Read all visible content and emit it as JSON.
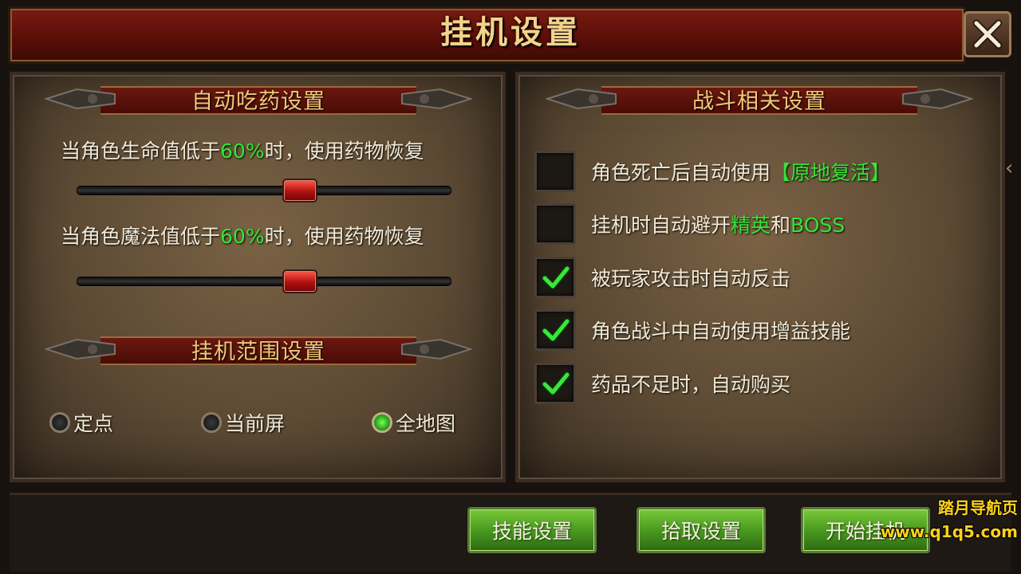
{
  "window": {
    "title": "挂机设置"
  },
  "left_panel": {
    "potion_header": "自动吃药设置",
    "hp": {
      "prefix": "当角色生命值低于",
      "percent": "60%",
      "suffix": "时，使用药物恢复",
      "slider_value": 0.6
    },
    "mp": {
      "prefix": "当角色魔法值低于",
      "percent": "60%",
      "suffix": "时，使用药物恢复",
      "slider_value": 0.6
    },
    "range_header": "挂机范围设置",
    "range_options": [
      {
        "label": "定点",
        "selected": false
      },
      {
        "label": "当前屏",
        "selected": false
      },
      {
        "label": "全地图",
        "selected": true
      }
    ]
  },
  "right_panel": {
    "header": "战斗相关设置",
    "options": [
      {
        "text": "角色死亡后自动使用",
        "highlight": "【原地复活】",
        "checked": false
      },
      {
        "text": "挂机时自动避开",
        "highlight": "精英",
        "mid": "和",
        "highlight2": "BOSS",
        "checked": false
      },
      {
        "text": "被玩家攻击时自动反击",
        "checked": true
      },
      {
        "text": "角色战斗中自动使用增益技能",
        "checked": true
      },
      {
        "text": "药品不足时，自动购买",
        "checked": true
      }
    ]
  },
  "buttons": {
    "skills": "技能设置",
    "pickup": "拾取设置",
    "start": "开始挂机"
  },
  "watermark": {
    "line1": "踏月导航页",
    "line2": "www.q1q5.com"
  },
  "icons": {
    "close": "close-x-icon",
    "check": "check-icon"
  },
  "colors": {
    "highlight_green": "#34e534",
    "title_gold": "#f3d28a",
    "button_green": "#4a9a20"
  }
}
